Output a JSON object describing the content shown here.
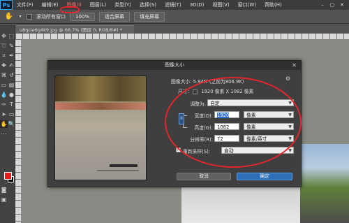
{
  "menubar": {
    "logo": "Ps",
    "items": [
      "文件(F)",
      "编辑(E)",
      "图像(I)",
      "图层(L)",
      "类型(Y)",
      "选择(S)",
      "滤镜(T)",
      "3D(D)",
      "视图(V)",
      "窗口(W)",
      "帮助(H)"
    ],
    "active_index": 2
  },
  "options": {
    "scroll_all": "滚动所有窗口",
    "zoom": "100%",
    "fit_screen": "适合屏幕",
    "fill_screen": "填充屏幕"
  },
  "doc_tab": {
    "title": "u8qcie6g4k9.jpg @ 66.7% (图层 0, RGB/8#) *"
  },
  "dialog": {
    "title": "图像大小",
    "image_size_label": "图像大小:",
    "image_size_value": "5.94M (之前为806.9K)",
    "dimensions_label": "尺寸:",
    "dimensions_value": "1920 像素 X 1082 像素",
    "fit_label": "调整为:",
    "fit_value": "自定",
    "width_label": "宽度(D):",
    "width_value": "1920",
    "width_unit": "像素",
    "height_label": "高度(G):",
    "height_value": "1082",
    "height_unit": "像素",
    "resolution_label": "分辨率(R):",
    "resolution_value": "72",
    "resolution_unit": "像素/英寸",
    "resample_label": "重新采样(S):",
    "resample_value": "自动",
    "cancel": "取消",
    "ok": "确定"
  },
  "colors": {
    "foreground": "#e31b1b",
    "background": "#000000",
    "annotation": "#e3262c",
    "primary_button": "#2e6fb9"
  }
}
